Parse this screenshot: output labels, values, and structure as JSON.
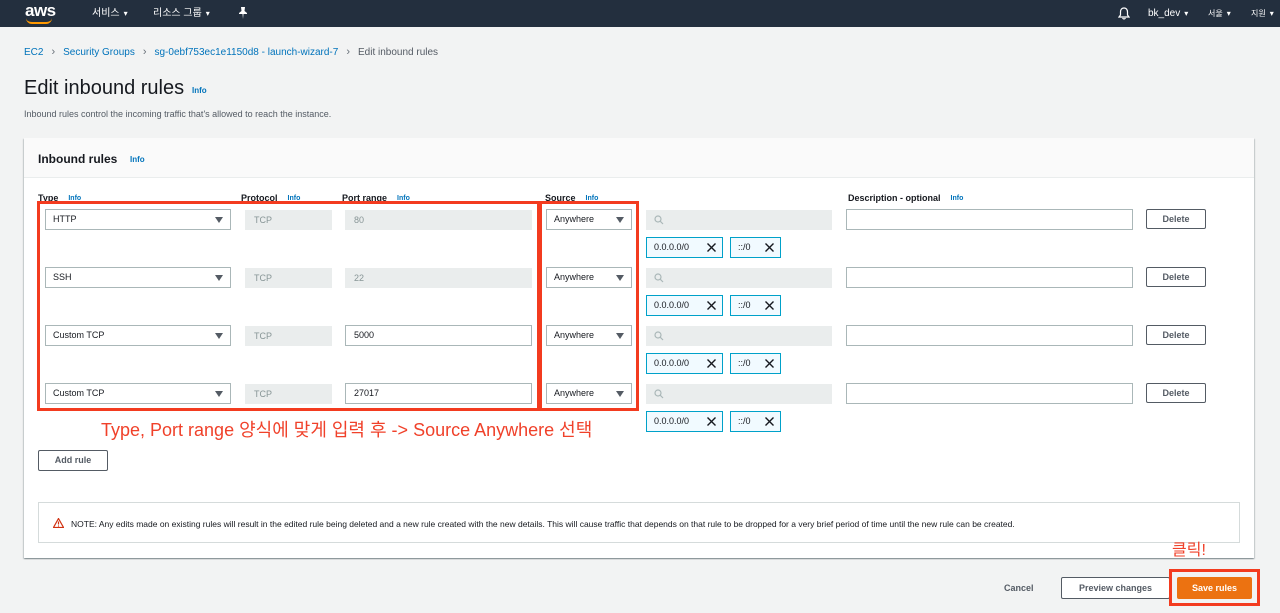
{
  "topnav": {
    "logo": "aws",
    "services": "서비스",
    "resource_groups": "리소스 그룹",
    "username": "bk_dev",
    "region": "서울",
    "support": "지원",
    "caret": "▾",
    "icons": [
      "pin-icon",
      "bell-icon"
    ]
  },
  "breadcrumb": {
    "items": [
      "EC2",
      "Security Groups",
      "sg-0ebf753ec1e1150d8 - launch-wizard-7"
    ],
    "current": "Edit inbound rules",
    "separator": "›"
  },
  "page": {
    "title": "Edit inbound rules",
    "info": "Info",
    "description": "Inbound rules control the incoming traffic that's allowed to reach the instance."
  },
  "panel": {
    "title": "Inbound rules",
    "info": "Info",
    "columns": {
      "type": "Type",
      "protocol": "Protocol",
      "port_range": "Port range",
      "source": "Source",
      "description": "Description - optional",
      "info": "Info"
    },
    "rules": [
      {
        "type": "HTTP",
        "protocol": "TCP",
        "port": "80",
        "source": "Anywhere",
        "cidrs": [
          "0.0.0.0/0",
          "::/0"
        ],
        "delete": "Delete"
      },
      {
        "type": "SSH",
        "protocol": "TCP",
        "port": "22",
        "source": "Anywhere",
        "cidrs": [
          "0.0.0.0/0",
          "::/0"
        ],
        "delete": "Delete"
      },
      {
        "type": "Custom TCP",
        "protocol": "TCP",
        "port": "5000",
        "source": "Anywhere",
        "cidrs": [
          "0.0.0.0/0",
          "::/0"
        ],
        "delete": "Delete"
      },
      {
        "type": "Custom TCP",
        "protocol": "TCP",
        "port": "27017",
        "source": "Anywhere",
        "cidrs": [
          "0.0.0.0/0",
          "::/0"
        ],
        "delete": "Delete"
      }
    ],
    "add_rule": "Add rule"
  },
  "alert": {
    "text": "NOTE: Any edits made on existing rules will result in the edited rule being deleted and a new rule created with the new details. This will cause traffic that depends on that rule to be dropped for a very brief period of time until the new rule can be created."
  },
  "annotations": {
    "instruction": "Type, Port range 양식에 맞게 입력 후 -> Source Anywhere 선택",
    "click": "클릭!",
    "color": "#f33b1f"
  },
  "footer": {
    "cancel": "Cancel",
    "preview": "Preview changes",
    "save": "Save rules"
  },
  "colors": {
    "nav_bg": "#232f3e",
    "accent_orange": "#ec7211",
    "link_blue": "#0073bb"
  }
}
